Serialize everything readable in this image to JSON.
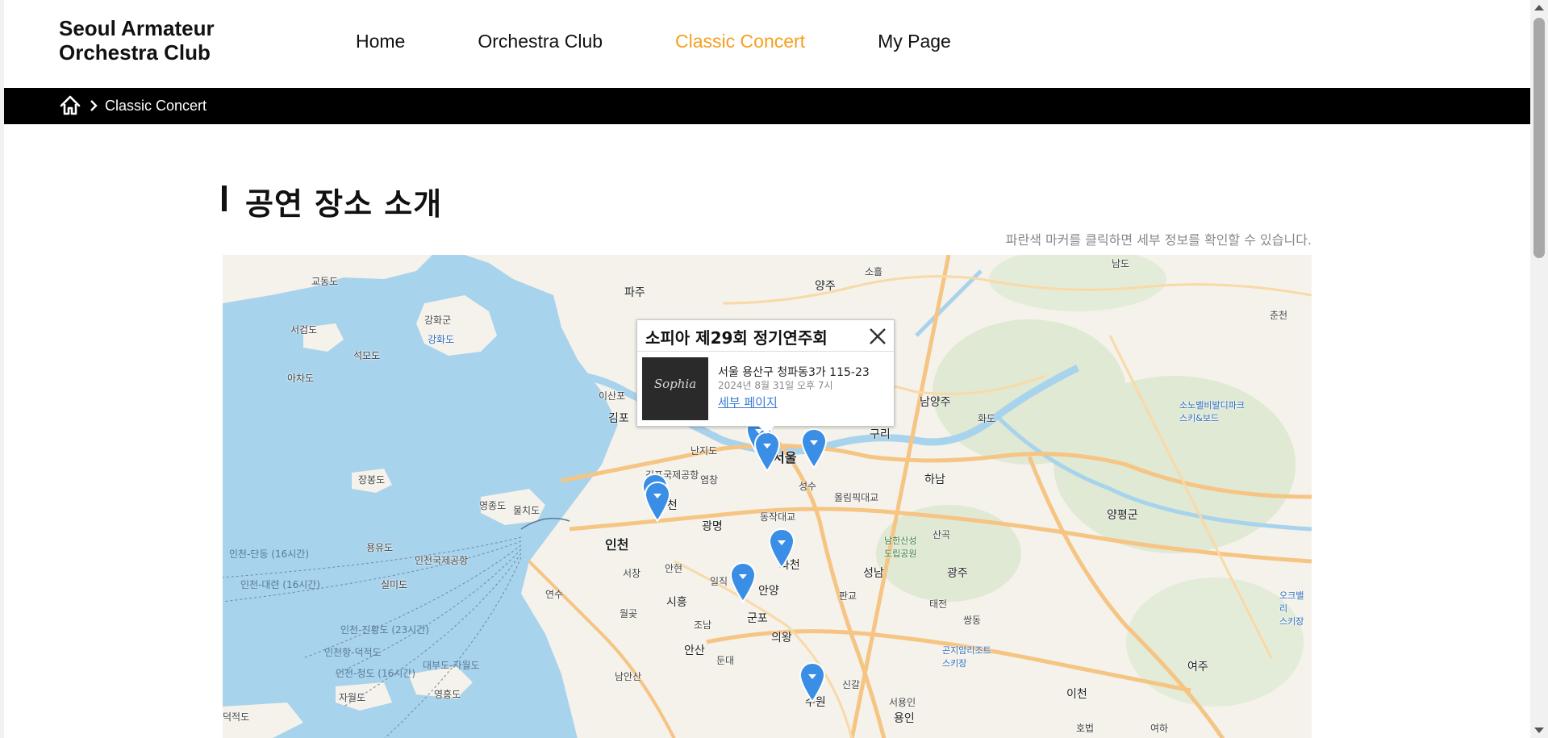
{
  "header": {
    "logo": "Seoul Armateur\nOrchestra Club",
    "nav": [
      {
        "label": "Home"
      },
      {
        "label": "Orchestra Club"
      },
      {
        "label": "Classic Concert",
        "active": true
      },
      {
        "label": "My Page"
      }
    ]
  },
  "breadcrumb": {
    "home_icon": "home-icon",
    "current": "Classic Concert"
  },
  "section": {
    "title": "공연 장소 소개",
    "hint": "파란색 마커를 클릭하면 세부 정보를 확인할 수 있습니다."
  },
  "map": {
    "labels": {
      "paju": "파주",
      "yangju": "양주",
      "gimpo": "김포",
      "seoul": "서울",
      "guri": "구리",
      "namyangju": "남양주",
      "hanam": "하남",
      "incheon": "인천",
      "gwangmyeong": "광명",
      "bucheon": "부천",
      "gwacheon": "과천",
      "anyang": "안양",
      "gunpo": "군포",
      "uiwang": "의왕",
      "ansan": "안산",
      "siheung": "시흥",
      "suwon": "수원",
      "seongnam": "성남",
      "gwangju": "광주",
      "yongin": "용인",
      "icheon": "이천",
      "yeoju": "여주",
      "yangpyeong": "양평군",
      "ganghwa_gun": "강화군",
      "ganghwa_do": "강화도",
      "gyodong": "교동도",
      "seokmo": "석모도",
      "seogeom": "서검도",
      "achado": "아차도",
      "jangbong": "장봉도",
      "yeongjong": "영종도",
      "muchi": "물치도",
      "yongyu": "용유도",
      "silmi": "실미도",
      "yeongheung": "영흥도",
      "jawol": "자월도",
      "deokjeok": "덕적도",
      "incheon_airport": "인천국제공항",
      "gimpo_airport": "김포국제공항",
      "ferry1": "인천-단동 (16시간)",
      "ferry2": "인천-대련 (16시간)",
      "ferry3": "인천-진황도 (23시간)",
      "ferry4": "인천항-덕적도",
      "ferry5": "인천-청도 (16시간)",
      "ferry6": "대부도-자월도",
      "namhansanseong": "남한산성\n도립공원",
      "sobel": "소노벨비발디파크\n스키&보드",
      "gonjiam": "곤지암리조트\n스키장",
      "oak": "오크밸리\n스키장",
      "ilsan": "이산포",
      "hwado": "화도",
      "gupabal": "난지도",
      "yeongdeungpo": "염창",
      "dongjak": "동작대교",
      "seongsu": "성수",
      "olympic": "올림픽대교",
      "sangildong": "산곡",
      "pangyo": "판교",
      "taejeon": "태전",
      "ssangdong": "쌍동",
      "anhyeon": "안현",
      "seochang": "서창",
      "yeonsu": "연수",
      "wolgot": "월곶",
      "joam": "조남",
      "donong": "둔대",
      "namansan": "남안산",
      "singal": "신갈",
      "seoyongin": "서용인",
      "hobeop": "호법",
      "yeoha": "여하",
      "namdo": "남도",
      "chuncheon": "춘천",
      "soheul": "소흘",
      "ilji": "일직"
    }
  },
  "popup": {
    "title": "소피아 제29회 정기연주회",
    "thumb_text": "Sophia",
    "address": "서울 용산구 청파동3가 115-23",
    "date": "2024년 8월 31일 오후 7시",
    "link": "세부 페이지"
  },
  "colors": {
    "accent": "#f5a01f",
    "marker": "#3a8ee6",
    "sea": "#a8d3ec",
    "land": "#f4f2ea",
    "road": "#f6c483"
  }
}
